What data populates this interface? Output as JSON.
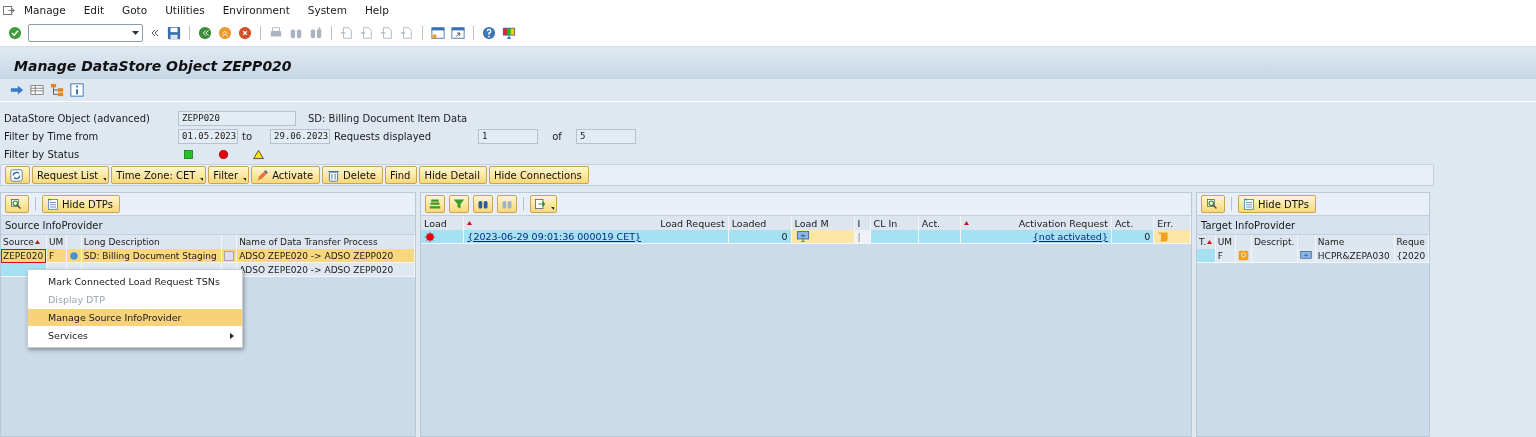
{
  "menu": [
    "Manage",
    "Edit",
    "Goto",
    "Utilities",
    "Environment",
    "System",
    "Help"
  ],
  "title": "Manage DataStore Object ZEPP020",
  "form": {
    "object_label": "DataStore Object (advanced)",
    "object_value": "ZEPP020",
    "object_description": "SD: Billing Document Item Data",
    "time_label": "Filter by Time from",
    "time_from": "01.05.2023",
    "to_label": "to",
    "time_to": "29.06.2023",
    "requests_label": "Requests displayed",
    "requests_shown": "1",
    "of_label": "of",
    "requests_total": "5",
    "status_label": "Filter by Status"
  },
  "buttons": [
    {
      "dropdown": false
    },
    {
      "label": "Request List",
      "dropdown": true
    },
    {
      "label": "Time Zone: CET",
      "dropdown": true
    },
    {
      "label": "Filter",
      "dropdown": true
    },
    {
      "label": "Activate",
      "dropdown": false
    },
    {
      "label": "Delete",
      "dropdown": false
    },
    {
      "label": "Find",
      "dropdown": false
    },
    {
      "label": "Hide Detail",
      "dropdown": false
    },
    {
      "label": "Hide Connections",
      "dropdown": false
    }
  ],
  "source_panel": {
    "button": "Hide DTPs",
    "title": "Source InfoProvider",
    "columns": [
      "Source",
      "UM",
      "",
      "Long Description",
      "",
      "Name of Data Transfer Process"
    ],
    "rows": [
      {
        "selected": true,
        "focused": true,
        "source": "ZEPE020",
        "um": "F",
        "long_description": "SD: Billing Document Staging",
        "dtp_name": "ADSO ZEPE020 -> ADSO ZEPP020"
      },
      {
        "selected": false,
        "focused": false,
        "dtp_name": "ADSO ZEPE020 -> ADSO ZEPP020"
      }
    ],
    "context_menu": [
      {
        "label": "Mark Connected Load Request TSNs",
        "disabled": false,
        "selected": false,
        "submenu": false
      },
      {
        "label": "Display DTP",
        "disabled": true,
        "selected": false,
        "submenu": false
      },
      {
        "label": "Manage Source InfoProvider",
        "disabled": false,
        "selected": true,
        "submenu": false
      },
      {
        "label": "Services",
        "disabled": false,
        "selected": false,
        "submenu": true
      }
    ]
  },
  "request_panel": {
    "columns": [
      "Load",
      "Load Request",
      "Loaded",
      "Load M",
      "I",
      "CL In",
      "Act.",
      "Activation Request",
      "Act.",
      "Err."
    ],
    "rows": [
      {
        "color": "#e8000b",
        "load_request": "{2023-06-29 09:01:36 000019 CET}",
        "loaded": "0",
        "separator": "|",
        "activation_request": "{not activated}",
        "activated": "0"
      }
    ]
  },
  "target_panel": {
    "button": "Hide DTPs",
    "title": "Target InfoProvider",
    "columns": [
      "T.",
      "UM",
      "",
      "Descript.",
      "",
      "Name",
      "Reque"
    ],
    "rows": [
      {
        "um": "F",
        "name": "HCPR&ZEPA030",
        "request": "{2020"
      }
    ]
  }
}
